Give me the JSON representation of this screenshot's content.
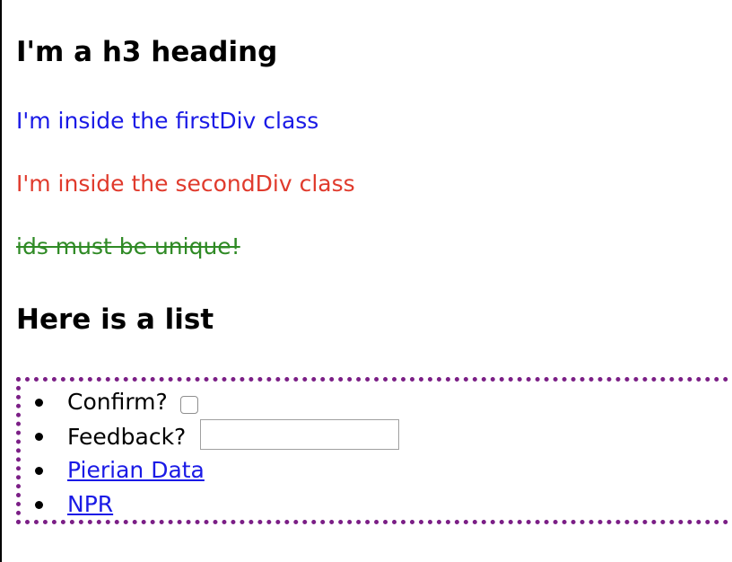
{
  "headings": {
    "top": "I'm a h3 heading",
    "list": "Here is a list"
  },
  "paragraphs": {
    "first_div": "I'm inside the firstDiv class",
    "second_div": "I'm inside the secondDiv class",
    "ids_note": "ids must be unique!"
  },
  "list": {
    "items": [
      {
        "label": "Confirm?"
      },
      {
        "label": "Feedback?"
      },
      {
        "label": "Pierian Data"
      },
      {
        "label": "NPR"
      }
    ]
  },
  "colors": {
    "first_div": "#1a1ae6",
    "second_div": "#e03a2c",
    "ids_note": "#2f8a25",
    "list_border": "#7b1f86",
    "link": "#1a1ae6"
  }
}
